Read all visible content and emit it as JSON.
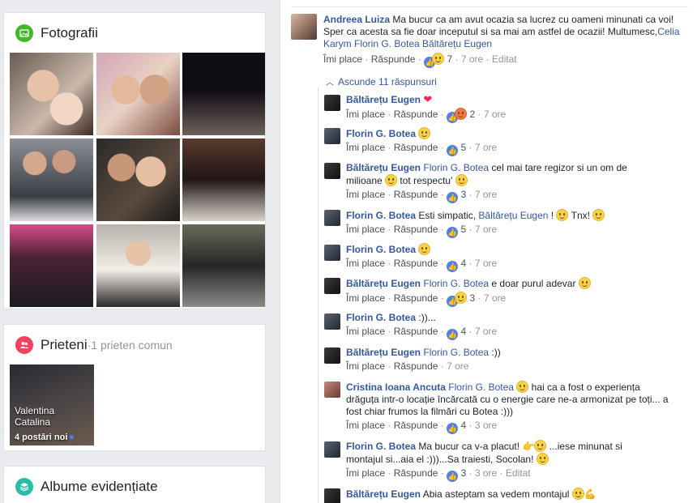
{
  "photos": {
    "title": "Fotografii"
  },
  "friends": {
    "title": "Prieteni",
    "sep": " · ",
    "subtitle": "1 prieten comun",
    "friend_name": "Valentina Catalina",
    "friend_posts": "4 postări noi"
  },
  "albums": {
    "title": "Albume evidențiate"
  },
  "main_comment": {
    "author": "Andreea Luiza",
    "text": "Ma bucur ca am avut ocazia sa lucrez cu oameni minunati ca voi! Sper ca acesta sa fie doar inceputul si sa mai am astfel de ocazii! Multumesc,",
    "tags": "Celia Karym Florin G. Botea Băltărețu Eugen",
    "like": "Îmi place",
    "reply": "Răspunde",
    "count": "7",
    "time": "7 ore",
    "edited": "Editat"
  },
  "hide_replies": "Ascunde 11 răspunsuri",
  "labels": {
    "like": "Îmi place",
    "reply": "Răspunde",
    "dot": "·",
    "edited": "Editat"
  },
  "replies": [
    {
      "author": "Băltărețu Eugen",
      "pre": "",
      "tag": "",
      "text": "",
      "count": "2",
      "time": "7 ore"
    },
    {
      "author": "Florin G. Botea",
      "pre": "",
      "tag": "",
      "text": "",
      "count": "5",
      "time": "7 ore"
    },
    {
      "author": "Băltărețu Eugen",
      "tag": "Florin G. Botea",
      "text": "cel mai tare regizor si un om de milioane",
      "text2": "tot respectu'",
      "count": "3",
      "time": "7 ore"
    },
    {
      "author": "Florin G. Botea",
      "text": "Esti simpatic,",
      "tag": "Băltărețu Eugen",
      "text2": "!",
      "text3": "Tnx!",
      "count": "5",
      "time": "7 ore"
    },
    {
      "author": "Florin G. Botea",
      "count": "4",
      "time": "7 ore"
    },
    {
      "author": "Băltărețu Eugen",
      "tag": "Florin G. Botea",
      "text": "e doar purul adevar",
      "count": "3",
      "time": "7 ore"
    },
    {
      "author": "Florin G. Botea",
      "text": ":))...",
      "count": "4",
      "time": "7 ore"
    },
    {
      "author": "Băltărețu Eugen",
      "tag": "Florin G. Botea",
      "text": ":))",
      "count": "",
      "time": "7 ore"
    },
    {
      "author": "Cristina Ioana Ancuta",
      "tag": "Florin G. Botea",
      "text": "hai ca a fost o experiența drăguța intr-o locație încărcată cu o energie care ne-a armonizat pe toți... a fost chiar frumos la filmări cu Botea :)))",
      "count": "4",
      "time": "3 ore"
    },
    {
      "author": "Florin G. Botea",
      "text": "Ma bucur ca v-a placut!",
      "text2": "...iese minunat si montajul si...aia el :)))...Sa traiesti, Socolan!",
      "count": "3",
      "time": "3 ore",
      "edited": "Editat"
    },
    {
      "author": "Băltărețu Eugen",
      "text": "Abia asteptam sa vedem montajul"
    }
  ],
  "colors": {
    "link": "#365899",
    "like_blue": "#4f7fe8",
    "green": "#42b72a",
    "pink": "#f3425f",
    "teal": "#2abba7"
  }
}
